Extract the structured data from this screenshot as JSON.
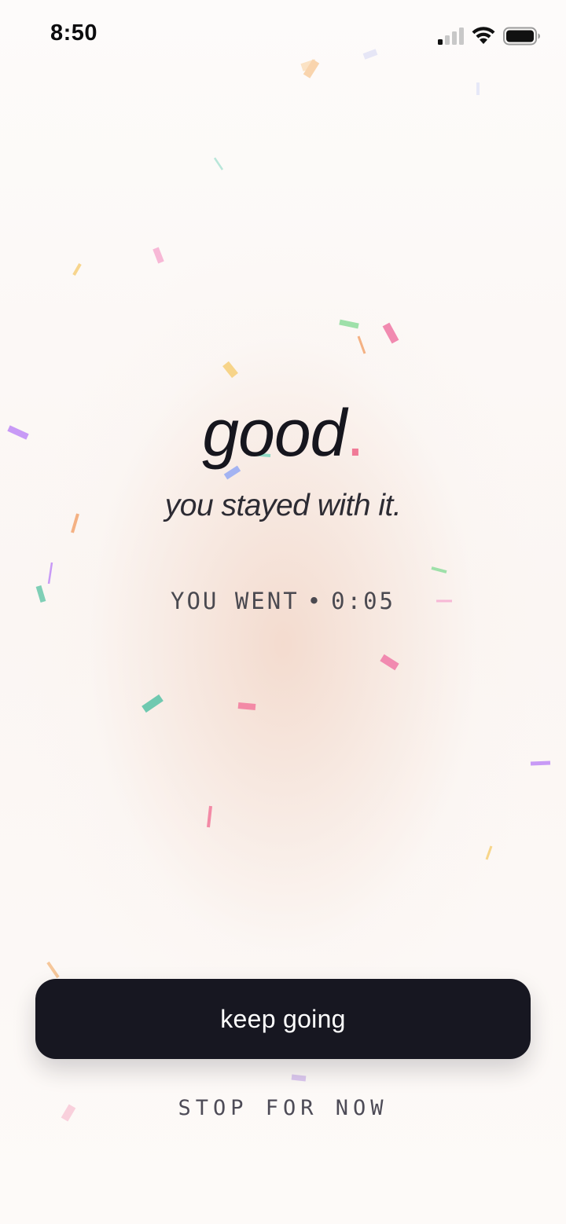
{
  "status_bar": {
    "time": "8:50"
  },
  "celebration": {
    "headline": "good",
    "headline_dot": ".",
    "subline": "you stayed with it.",
    "duration_label": "YOU WENT",
    "duration_separator": "•",
    "duration_value": "0:05"
  },
  "actions": {
    "primary_label": "keep going",
    "secondary_label": "STOP FOR NOW"
  },
  "colors": {
    "accent_dot": "#f07a97",
    "button_background": "#171721",
    "text_primary": "#16161e"
  },
  "icons": [
    "signal-icon",
    "wifi-icon",
    "battery-icon"
  ]
}
